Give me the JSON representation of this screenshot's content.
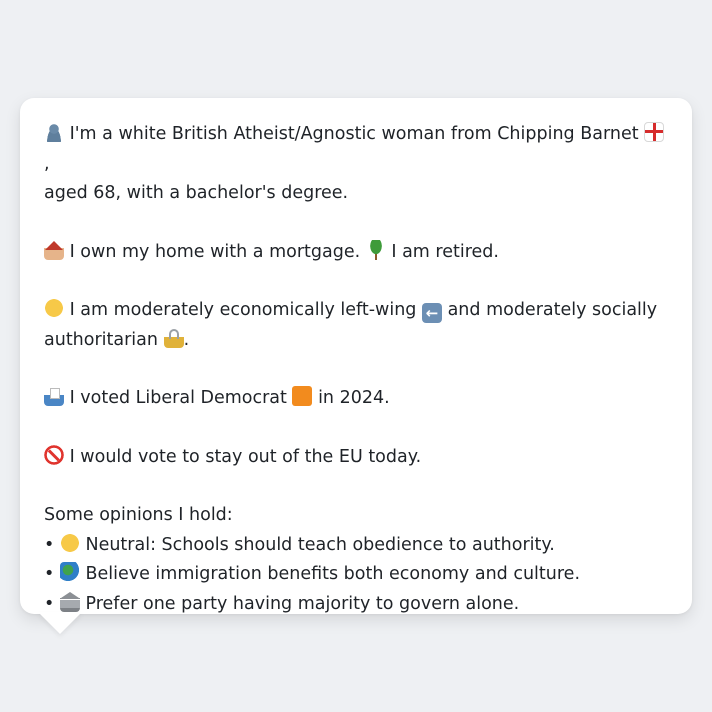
{
  "message": {
    "identity_line1": "I'm a white British Atheist/Agnostic woman from Chipping Barnet",
    "identity_line1_end": ",",
    "identity_line2": "aged 68, with a bachelor's degree.",
    "home": "I own my home with a mortgage.",
    "retired": "I am retired.",
    "econ_line1": "I am moderately economically left-wing",
    "econ_line1_tail": "and moderately socially",
    "econ_line2": "authoritarian",
    "econ_line2_end": ".",
    "vote_a": "I voted Liberal Democrat",
    "vote_b": "in 2024.",
    "eu": "I would vote to stay out of the EU today.",
    "opinions_heading": "Some opinions I hold:",
    "opinions": [
      "Neutral: Schools should teach obedience to authority.",
      "Believe immigration benefits both economy and culture.",
      "Prefer one party having majority to govern alone."
    ],
    "bullet": "•"
  },
  "icons": {
    "person": "bust-silhouette-icon",
    "flag": "england-flag-icon",
    "home": "house-icon",
    "retired": "palm-tree-icon",
    "thinking": "thinking-face-icon",
    "left_arrow": "left-arrow-icon",
    "lock": "lock-icon",
    "ballot": "ballot-box-icon",
    "party": "orange-square-icon",
    "no_entry": "prohibited-icon",
    "neutral": "neutral-face-icon",
    "globe": "globe-icon",
    "government": "classical-building-icon"
  },
  "colors": {
    "background": "#eef0f3",
    "card": "#ffffff",
    "text": "#1f2328",
    "party_orange": "#f28b1e"
  }
}
